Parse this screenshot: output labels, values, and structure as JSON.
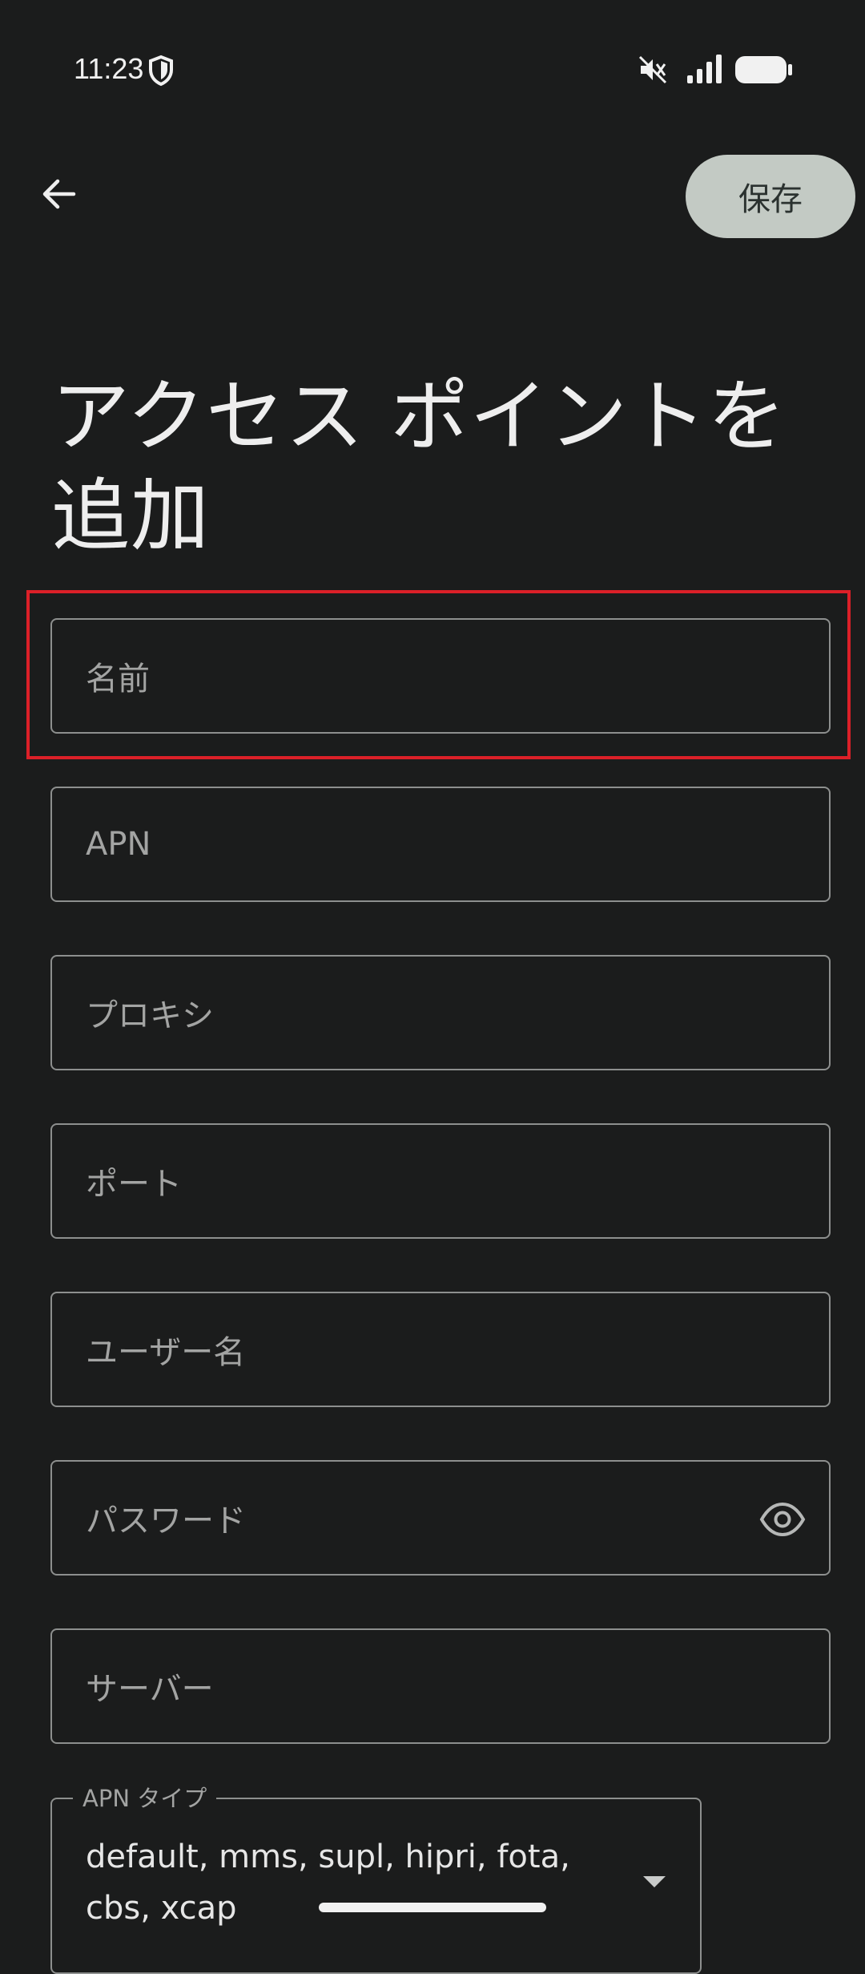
{
  "status_bar": {
    "time": "11:23"
  },
  "app_bar": {
    "back_icon": "arrow-left-icon",
    "save_label": "保存"
  },
  "title": "アクセス ポイントを追加",
  "fields": [
    {
      "placeholder": "名前"
    },
    {
      "placeholder": "APN"
    },
    {
      "placeholder": "プロキシ"
    },
    {
      "placeholder": "ポート"
    },
    {
      "placeholder": "ユーザー名"
    },
    {
      "placeholder": "パスワード",
      "trailing_icon": "eye-icon"
    },
    {
      "placeholder": "サーバー"
    }
  ],
  "apn_type": {
    "label": "APN タイプ",
    "value": "default, mms, supl, hipri, fota, cbs, xcap"
  },
  "colors": {
    "background": "#1b1c1c",
    "save_button": "#c3cac4",
    "field_border": "#8d8f8e",
    "highlight": "#dc2028"
  }
}
